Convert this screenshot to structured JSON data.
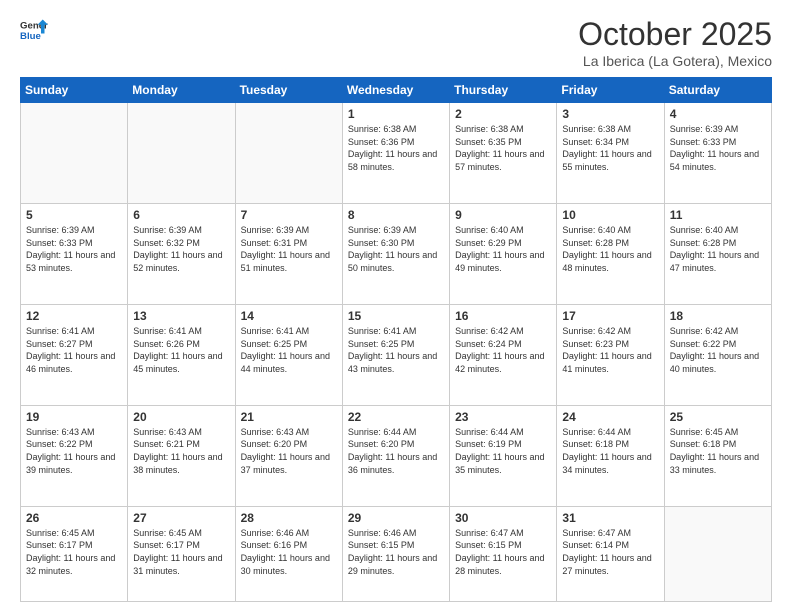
{
  "header": {
    "logo_general": "General",
    "logo_blue": "Blue",
    "month_title": "October 2025",
    "subtitle": "La Iberica (La Gotera), Mexico"
  },
  "weekdays": [
    "Sunday",
    "Monday",
    "Tuesday",
    "Wednesday",
    "Thursday",
    "Friday",
    "Saturday"
  ],
  "weeks": [
    [
      {
        "day": "",
        "info": ""
      },
      {
        "day": "",
        "info": ""
      },
      {
        "day": "",
        "info": ""
      },
      {
        "day": "1",
        "info": "Sunrise: 6:38 AM\nSunset: 6:36 PM\nDaylight: 11 hours and 58 minutes."
      },
      {
        "day": "2",
        "info": "Sunrise: 6:38 AM\nSunset: 6:35 PM\nDaylight: 11 hours and 57 minutes."
      },
      {
        "day": "3",
        "info": "Sunrise: 6:38 AM\nSunset: 6:34 PM\nDaylight: 11 hours and 55 minutes."
      },
      {
        "day": "4",
        "info": "Sunrise: 6:39 AM\nSunset: 6:33 PM\nDaylight: 11 hours and 54 minutes."
      }
    ],
    [
      {
        "day": "5",
        "info": "Sunrise: 6:39 AM\nSunset: 6:33 PM\nDaylight: 11 hours and 53 minutes."
      },
      {
        "day": "6",
        "info": "Sunrise: 6:39 AM\nSunset: 6:32 PM\nDaylight: 11 hours and 52 minutes."
      },
      {
        "day": "7",
        "info": "Sunrise: 6:39 AM\nSunset: 6:31 PM\nDaylight: 11 hours and 51 minutes."
      },
      {
        "day": "8",
        "info": "Sunrise: 6:39 AM\nSunset: 6:30 PM\nDaylight: 11 hours and 50 minutes."
      },
      {
        "day": "9",
        "info": "Sunrise: 6:40 AM\nSunset: 6:29 PM\nDaylight: 11 hours and 49 minutes."
      },
      {
        "day": "10",
        "info": "Sunrise: 6:40 AM\nSunset: 6:28 PM\nDaylight: 11 hours and 48 minutes."
      },
      {
        "day": "11",
        "info": "Sunrise: 6:40 AM\nSunset: 6:28 PM\nDaylight: 11 hours and 47 minutes."
      }
    ],
    [
      {
        "day": "12",
        "info": "Sunrise: 6:41 AM\nSunset: 6:27 PM\nDaylight: 11 hours and 46 minutes."
      },
      {
        "day": "13",
        "info": "Sunrise: 6:41 AM\nSunset: 6:26 PM\nDaylight: 11 hours and 45 minutes."
      },
      {
        "day": "14",
        "info": "Sunrise: 6:41 AM\nSunset: 6:25 PM\nDaylight: 11 hours and 44 minutes."
      },
      {
        "day": "15",
        "info": "Sunrise: 6:41 AM\nSunset: 6:25 PM\nDaylight: 11 hours and 43 minutes."
      },
      {
        "day": "16",
        "info": "Sunrise: 6:42 AM\nSunset: 6:24 PM\nDaylight: 11 hours and 42 minutes."
      },
      {
        "day": "17",
        "info": "Sunrise: 6:42 AM\nSunset: 6:23 PM\nDaylight: 11 hours and 41 minutes."
      },
      {
        "day": "18",
        "info": "Sunrise: 6:42 AM\nSunset: 6:22 PM\nDaylight: 11 hours and 40 minutes."
      }
    ],
    [
      {
        "day": "19",
        "info": "Sunrise: 6:43 AM\nSunset: 6:22 PM\nDaylight: 11 hours and 39 minutes."
      },
      {
        "day": "20",
        "info": "Sunrise: 6:43 AM\nSunset: 6:21 PM\nDaylight: 11 hours and 38 minutes."
      },
      {
        "day": "21",
        "info": "Sunrise: 6:43 AM\nSunset: 6:20 PM\nDaylight: 11 hours and 37 minutes."
      },
      {
        "day": "22",
        "info": "Sunrise: 6:44 AM\nSunset: 6:20 PM\nDaylight: 11 hours and 36 minutes."
      },
      {
        "day": "23",
        "info": "Sunrise: 6:44 AM\nSunset: 6:19 PM\nDaylight: 11 hours and 35 minutes."
      },
      {
        "day": "24",
        "info": "Sunrise: 6:44 AM\nSunset: 6:18 PM\nDaylight: 11 hours and 34 minutes."
      },
      {
        "day": "25",
        "info": "Sunrise: 6:45 AM\nSunset: 6:18 PM\nDaylight: 11 hours and 33 minutes."
      }
    ],
    [
      {
        "day": "26",
        "info": "Sunrise: 6:45 AM\nSunset: 6:17 PM\nDaylight: 11 hours and 32 minutes."
      },
      {
        "day": "27",
        "info": "Sunrise: 6:45 AM\nSunset: 6:17 PM\nDaylight: 11 hours and 31 minutes."
      },
      {
        "day": "28",
        "info": "Sunrise: 6:46 AM\nSunset: 6:16 PM\nDaylight: 11 hours and 30 minutes."
      },
      {
        "day": "29",
        "info": "Sunrise: 6:46 AM\nSunset: 6:15 PM\nDaylight: 11 hours and 29 minutes."
      },
      {
        "day": "30",
        "info": "Sunrise: 6:47 AM\nSunset: 6:15 PM\nDaylight: 11 hours and 28 minutes."
      },
      {
        "day": "31",
        "info": "Sunrise: 6:47 AM\nSunset: 6:14 PM\nDaylight: 11 hours and 27 minutes."
      },
      {
        "day": "",
        "info": ""
      }
    ]
  ]
}
